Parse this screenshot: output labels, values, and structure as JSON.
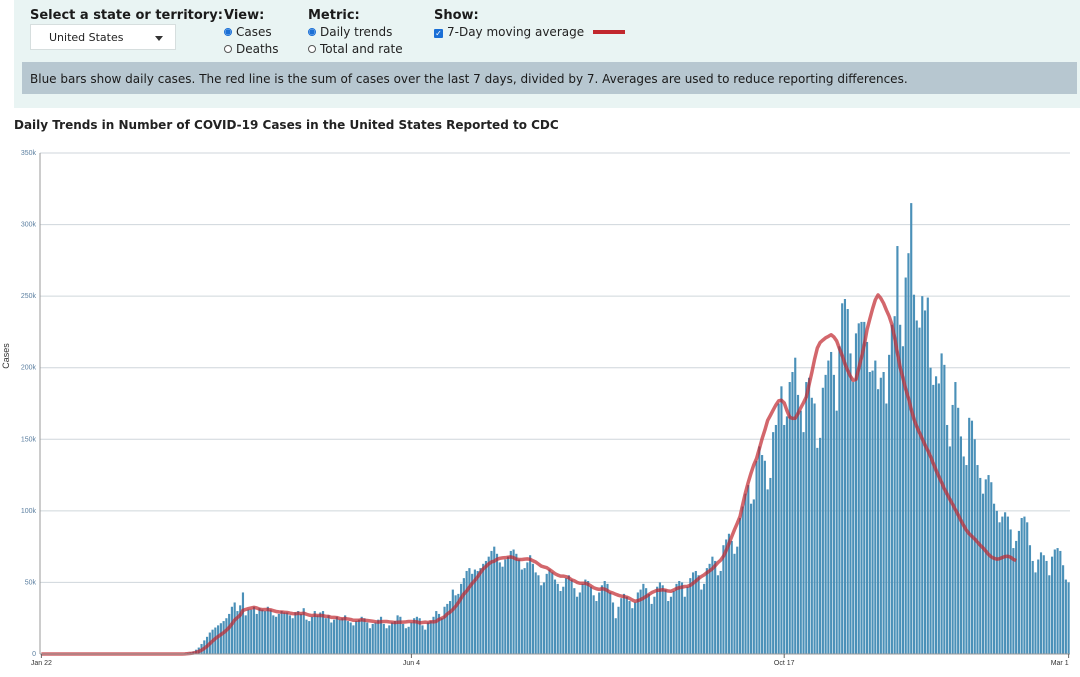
{
  "controls": {
    "state_label": "Select a state or territory:",
    "state_value": "United States",
    "view_label": "View:",
    "view_options": [
      "Cases",
      "Deaths"
    ],
    "metric_label": "Metric:",
    "metric_options": [
      "Daily trends",
      "Total and rate"
    ],
    "show_label": "Show:",
    "show_option": "7-Day moving average",
    "line_color": "#c1272d"
  },
  "note": "Blue bars show daily cases. The red line is the sum of cases over the last 7 days, divided by 7. Averages are used to reduce reporting differences.",
  "chart_data": {
    "type": "bar",
    "title": "Daily Trends in Number of COVID-19 Cases in the United States Reported to CDC",
    "xlabel": "",
    "ylabel": "Cases",
    "ylim": [
      0,
      350000
    ],
    "y_ticks": [
      "0",
      "50k",
      "100k",
      "150k",
      "200k",
      "250k",
      "300k",
      "350k"
    ],
    "x_ticks": [
      "Jan 22",
      "Jun 4",
      "Oct 17",
      "Mar 1"
    ],
    "bar_color": "#4a90b8",
    "avg_color": "#c1272d",
    "grid": true,
    "series": [
      {
        "name": "Daily cases",
        "kind": "bar",
        "values": [
          0,
          0,
          0,
          0,
          0,
          0,
          0,
          0,
          0,
          0,
          0,
          0,
          0,
          0,
          0,
          0,
          0,
          0,
          0,
          0,
          0,
          0,
          0,
          0,
          0,
          0,
          0,
          0,
          0,
          0,
          0,
          0,
          0,
          0,
          0,
          0,
          0,
          0,
          0,
          0,
          0,
          0,
          0,
          0,
          0,
          0,
          0,
          0,
          0,
          0,
          0,
          300,
          500,
          800,
          1200,
          1800,
          3000,
          4500,
          7000,
          9500,
          12000,
          15000,
          17000,
          18500,
          20000,
          21500,
          23000,
          25000,
          28000,
          33000,
          36000,
          30000,
          34000,
          43000,
          27000,
          31000,
          31000,
          33000,
          28000,
          32000,
          31000,
          30000,
          33000,
          31000,
          27000,
          26000,
          28000,
          30000,
          29000,
          29000,
          27000,
          25000,
          29000,
          30000,
          28000,
          32000,
          24000,
          23000,
          26000,
          30000,
          27000,
          29000,
          30000,
          25000,
          27000,
          22000,
          24000,
          26000,
          24000,
          25000,
          27000,
          23000,
          22000,
          20000,
          23000,
          24000,
          26000,
          25000,
          22000,
          18000,
          21000,
          22000,
          24000,
          26000,
          21000,
          18000,
          20000,
          22000,
          23000,
          27000,
          26000,
          21000,
          18000,
          19000,
          22000,
          25000,
          26000,
          25000,
          20000,
          17000,
          22000,
          23000,
          26000,
          30000,
          28000,
          25000,
          33000,
          35000,
          37000,
          45000,
          41000,
          42000,
          49000,
          53000,
          58000,
          60000,
          56000,
          59000,
          58000,
          60000,
          63000,
          65000,
          68000,
          72000,
          75000,
          70000,
          64000,
          61000,
          66000,
          68000,
          72000,
          73000,
          70000,
          66000,
          59000,
          60000,
          64000,
          69000,
          63000,
          57000,
          55000,
          48000,
          50000,
          56000,
          59000,
          57000,
          52000,
          49000,
          44000,
          47000,
          53000,
          55000,
          52000,
          46000,
          40000,
          43000,
          49000,
          52000,
          51000,
          47000,
          41000,
          37000,
          43000,
          48000,
          51000,
          49000,
          43000,
          36000,
          25000,
          33000,
          39000,
          42000,
          40000,
          37000,
          32000,
          36000,
          43000,
          45000,
          49000,
          46000,
          42000,
          35000,
          40000,
          47000,
          50000,
          48000,
          45000,
          37000,
          40000,
          44000,
          49000,
          51000,
          50000,
          40000,
          47000,
          53000,
          57000,
          58000,
          55000,
          45000,
          49000,
          60000,
          63000,
          68000,
          65000,
          55000,
          58000,
          76000,
          80000,
          84000,
          79000,
          70000,
          75000,
          95000,
          103000,
          112000,
          118000,
          105000,
          108000,
          135000,
          145000,
          139000,
          135000,
          115000,
          123000,
          155000,
          160000,
          175000,
          187000,
          160000,
          166000,
          190000,
          197000,
          207000,
          181000,
          170000,
          155000,
          190000,
          193000,
          179000,
          175000,
          144000,
          151000,
          186000,
          195000,
          205000,
          211000,
          195000,
          170000,
          215000,
          245000,
          248000,
          241000,
          210000,
          190000,
          224000,
          231000,
          232000,
          232000,
          218000,
          197000,
          198000,
          205000,
          185000,
          193000,
          197000,
          175000,
          209000,
          230000,
          236000,
          285000,
          230000,
          215000,
          263000,
          280000,
          315000,
          251000,
          233000,
          228000,
          250000,
          240000,
          249000,
          200000,
          188000,
          194000,
          189000,
          210000,
          202000,
          160000,
          145000,
          174000,
          190000,
          172000,
          152000,
          138000,
          132000,
          165000,
          163000,
          150000,
          132000,
          123000,
          112000,
          122000,
          125000,
          120000,
          105000,
          100000,
          92000,
          96000,
          99000,
          96000,
          87000,
          74000,
          79000,
          86000,
          95000,
          96000,
          92000,
          76000,
          65000,
          57000,
          66000,
          71000,
          69000,
          65000,
          55000,
          68000,
          73000,
          74000,
          72000,
          62000,
          52000,
          50000
        ]
      },
      {
        "name": "7-Day moving average",
        "kind": "line",
        "values": [
          0,
          0,
          0,
          0,
          0,
          0,
          0,
          0,
          0,
          0,
          0,
          0,
          0,
          0,
          0,
          0,
          0,
          0,
          0,
          0,
          0,
          0,
          0,
          0,
          0,
          0,
          0,
          0,
          0,
          0,
          0,
          0,
          0,
          0,
          0,
          0,
          0,
          0,
          0,
          0,
          0,
          0,
          0,
          0,
          0,
          0,
          0,
          0,
          0,
          0,
          0,
          43,
          114,
          229,
          400,
          657,
          1086,
          1729,
          2700,
          3900,
          5429,
          7286,
          9071,
          10786,
          12213,
          13557,
          14931,
          16571,
          18500,
          21000,
          23786,
          25429,
          27143,
          30429,
          31143,
          31714,
          32143,
          32571,
          32143,
          31357,
          31000,
          31071,
          31071,
          30857,
          30286,
          29714,
          29429,
          29357,
          29143,
          29000,
          28571,
          28214,
          28143,
          28429,
          28214,
          28500,
          27786,
          27143,
          26857,
          27143,
          26857,
          26857,
          26786,
          26286,
          26286,
          25571,
          25571,
          25429,
          24857,
          24571,
          24857,
          24429,
          24143,
          23571,
          23571,
          23571,
          24000,
          23571,
          23429,
          23143,
          22857,
          22571,
          22286,
          22571,
          22714,
          22714,
          22429,
          22286,
          22000,
          22143,
          22286,
          22286,
          22429,
          22714,
          22714,
          22571,
          22429,
          21714,
          22000,
          22286,
          22000,
          22571,
          22429,
          22786,
          24214,
          25000,
          26000,
          28000,
          29286,
          31071,
          33286,
          35857,
          39000,
          42000,
          44000,
          46714,
          49286,
          51429,
          54000,
          56857,
          59429,
          61143,
          63000,
          64286,
          64857,
          66143,
          66857,
          67143,
          67286,
          67571,
          67857,
          67286,
          66286,
          66000,
          66000,
          66286,
          66429,
          66143,
          65143,
          64286,
          62857,
          61429,
          60857,
          60286,
          59000,
          57571,
          56143,
          55143,
          54429,
          54429,
          54000,
          53286,
          51857,
          51143,
          50000,
          49429,
          49429,
          49429,
          48714,
          47571,
          46286,
          45571,
          45143,
          45571,
          45286,
          44286,
          43143,
          42571,
          41714,
          41000,
          40429,
          40143,
          39714,
          38857,
          37714,
          36857,
          37286,
          38000,
          39000,
          40143,
          41571,
          42857,
          43714,
          44571,
          44571,
          44857,
          44571,
          44000,
          43857,
          44714,
          45714,
          46286,
          46714,
          47143,
          47286,
          48000,
          49429,
          51000,
          52714,
          54143,
          55286,
          56857,
          58143,
          59571,
          61714,
          63857,
          65571,
          68286,
          72286,
          77143,
          82000,
          86857,
          91286,
          96000,
          104571,
          112857,
          120000,
          126429,
          132143,
          136571,
          143429,
          150429,
          156429,
          163143,
          166714,
          170429,
          174000,
          176857,
          177286,
          175429,
          170000,
          165429,
          164571,
          164714,
          168000,
          172000,
          175571,
          179571,
          188143,
          196571,
          205857,
          213714,
          217571,
          219286,
          220857,
          221857,
          223000,
          221429,
          218714,
          213429,
          208571,
          202714,
          198000,
          194000,
          191143,
          191857,
          199571,
          207286,
          215857,
          226571,
          234000,
          241143,
          247429,
          250857,
          248429,
          245000,
          240286,
          236000,
          230143,
          221000,
          210286,
          200286,
          192857,
          185000,
          178857,
          171000,
          164143,
          158857,
          154571,
          150429,
          146000,
          142143,
          138000,
          133143,
          128429,
          124000,
          119857,
          115429,
          111714,
          108000,
          104571,
          100857,
          97286,
          93286,
          89714,
          86429,
          84000,
          82143,
          80286,
          78143,
          76000,
          74143,
          71857,
          69571,
          67857,
          66857,
          66286,
          66571,
          67429,
          68143,
          68286,
          67571,
          66143,
          65286
        ]
      }
    ]
  }
}
